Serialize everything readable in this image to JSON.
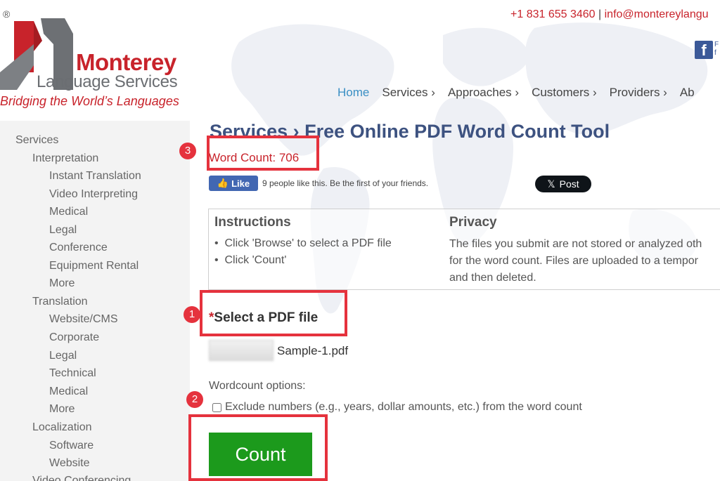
{
  "logo": {
    "reg": "®",
    "brand_line1": "Monterey",
    "brand_line2": "Language Services",
    "tagline": "Bridging the World’s Languages"
  },
  "contact": {
    "phone": "+1 831 655 3460",
    "separator": "|",
    "email": "info@montereylangu"
  },
  "facebook": {
    "icon": "facebook-icon",
    "letter": "f",
    "text_line1": "F",
    "text_line2": "f"
  },
  "nav": [
    {
      "label": "Home",
      "active": true
    },
    {
      "label": "Services ›"
    },
    {
      "label": "Approaches ›"
    },
    {
      "label": "Customers ›"
    },
    {
      "label": "Providers ›"
    },
    {
      "label": "Ab"
    }
  ],
  "sidebar": {
    "items": [
      {
        "label": "Services",
        "level": 0
      },
      {
        "label": "Interpretation",
        "level": 1
      },
      {
        "label": "Instant Translation",
        "level": 2
      },
      {
        "label": "Video Interpreting",
        "level": 2
      },
      {
        "label": "Medical",
        "level": 2
      },
      {
        "label": "Legal",
        "level": 2
      },
      {
        "label": "Conference",
        "level": 2
      },
      {
        "label": "Equipment Rental",
        "level": 2
      },
      {
        "label": "More",
        "level": 2
      },
      {
        "label": "Translation",
        "level": 1
      },
      {
        "label": "Website/CMS",
        "level": 2
      },
      {
        "label": "Corporate",
        "level": 2
      },
      {
        "label": "Legal",
        "level": 2
      },
      {
        "label": "Technical",
        "level": 2
      },
      {
        "label": "Medical",
        "level": 2
      },
      {
        "label": "More",
        "level": 2
      },
      {
        "label": "Localization",
        "level": 1
      },
      {
        "label": "Software",
        "level": 2
      },
      {
        "label": "Website",
        "level": 2
      },
      {
        "label": "Video Conferencing",
        "level": 1
      }
    ]
  },
  "main": {
    "title": "Services › Free Online PDF Word Count Tool",
    "word_count": "Word Count: 706",
    "like_label": "Like",
    "like_text": "9 people like this. Be the first of your friends.",
    "post_label": "Post",
    "instructions": {
      "heading": "Instructions",
      "items": [
        "Click 'Browse' to select a PDF file",
        "Click 'Count'"
      ]
    },
    "privacy": {
      "heading": "Privacy",
      "lines": [
        "The files you submit are not stored or analyzed oth",
        "for the word count. Files are uploaded to a tempor",
        "and then deleted."
      ]
    },
    "select_required": "*",
    "select_label": "Select a PDF file",
    "file_name": "Sample-1.pdf",
    "options_label": "Wordcount options:",
    "exclude_label": "Exclude numbers (e.g., years, dollar amounts, etc.) from the word count",
    "exclude_checked": false,
    "count_label": "Count"
  },
  "annotations": [
    {
      "label": "1"
    },
    {
      "label": "2"
    },
    {
      "label": "3"
    }
  ],
  "colors": {
    "brand_red": "#c8232b",
    "nav_active": "#3a8fc4",
    "title_blue": "#3d5280",
    "count_green": "#1c9a1c",
    "annotation_red": "#e5323d",
    "facebook_blue": "#4267b2"
  }
}
